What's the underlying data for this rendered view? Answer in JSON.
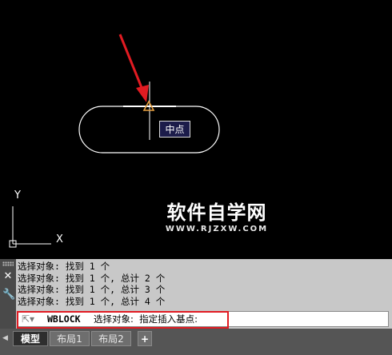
{
  "snap_tooltip": "中点",
  "watermark": {
    "main": "软件自学网",
    "sub": "WWW.RJZXW.COM"
  },
  "ucs": {
    "y_label": "Y",
    "x_label": "X"
  },
  "command_history": [
    "选择对象: 找到 1 个",
    "选择对象: 找到 1 个, 总计 2 个",
    "选择对象: 找到 1 个, 总计 3 个",
    "选择对象: 找到 1 个, 总计 4 个"
  ],
  "command_line": {
    "command": "WBLOCK",
    "prompt": "选择对象:  指定插入基点:"
  },
  "layout_tabs": {
    "model": "模型",
    "layout1": "布局1",
    "layout2": "布局2",
    "add": "+"
  },
  "colors": {
    "annotation_red": "#e11b22",
    "snap_marker": "#e8a040",
    "geometry": "#ffffff"
  }
}
